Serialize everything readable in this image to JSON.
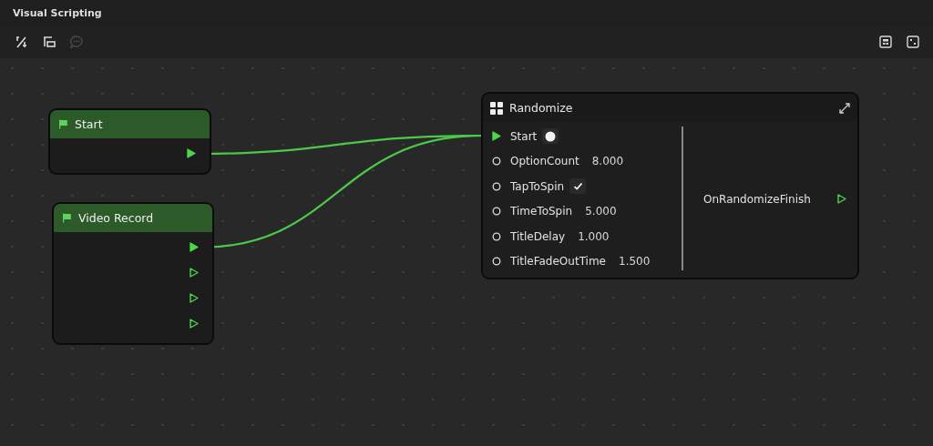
{
  "window": {
    "title": "Visual Scripting"
  },
  "toolbar": {
    "left": [
      {
        "kind": "curve",
        "disabled": false
      },
      {
        "kind": "group",
        "disabled": false
      },
      {
        "kind": "comment",
        "disabled": true
      }
    ],
    "right": [
      {
        "kind": "layout",
        "disabled": false
      },
      {
        "kind": "fit",
        "disabled": false
      }
    ]
  },
  "nodes": [
    {
      "kind": "event",
      "title": "Start",
      "outputs": [
        {
          "connected": true
        }
      ]
    },
    {
      "kind": "event",
      "title": "Video Record",
      "outputs": [
        {
          "connected": true
        },
        {
          "connected": false
        },
        {
          "connected": false
        },
        {
          "connected": false
        }
      ]
    },
    {
      "kind": "function",
      "title": "Randomize",
      "inputs": [
        {
          "kind": "exec",
          "label": "Start",
          "connected": true
        },
        {
          "kind": "value",
          "label": "OptionCount",
          "value": "8.000",
          "connected": false
        },
        {
          "kind": "toggle",
          "label": "TapToSpin",
          "checked": true,
          "connected": false
        },
        {
          "kind": "value",
          "label": "TimeToSpin",
          "value": "5.000",
          "connected": false
        },
        {
          "kind": "value",
          "label": "TitleDelay",
          "value": "1.000",
          "connected": false
        },
        {
          "kind": "value",
          "label": "TitleFadeOutTime",
          "value": "1.500",
          "connected": false
        }
      ],
      "outputs": [
        {
          "label": "OnRandomizeFinish",
          "connected": false
        }
      ]
    }
  ]
}
